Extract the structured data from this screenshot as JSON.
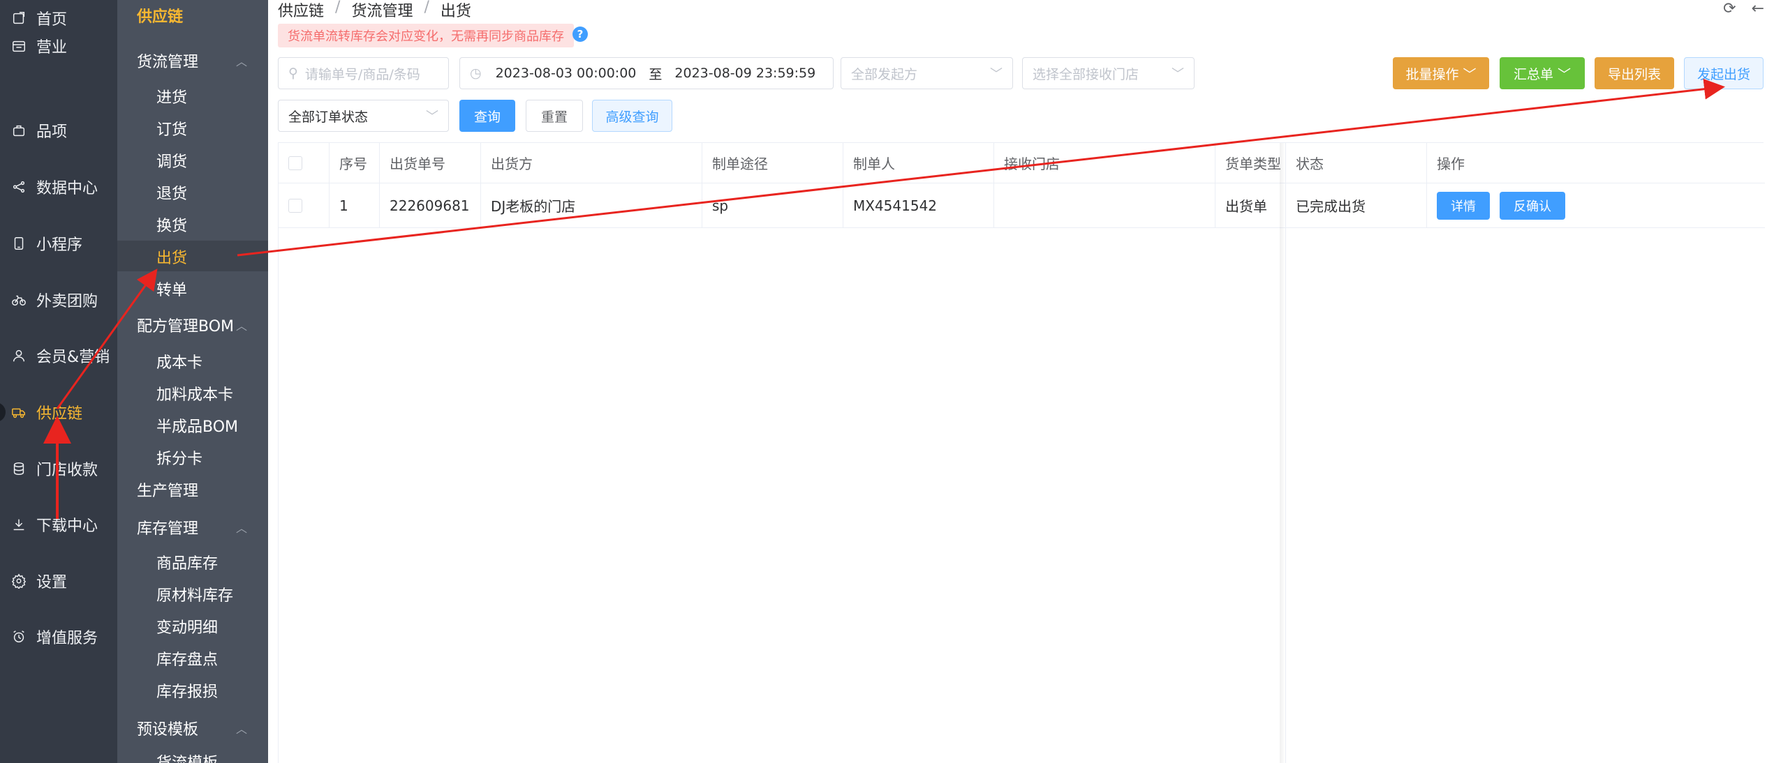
{
  "nav": {
    "items": [
      {
        "label": "首页",
        "icon": "home-icon"
      },
      {
        "label": "营业",
        "icon": "calendar-icon"
      },
      {
        "label": "品项",
        "icon": "bag-icon"
      },
      {
        "label": "数据中心",
        "icon": "share-icon"
      },
      {
        "label": "小程序",
        "icon": "phone-icon"
      },
      {
        "label": "外卖团购",
        "icon": "bike-icon"
      },
      {
        "label": "会员&营销",
        "icon": "user-icon"
      },
      {
        "label": "供应链",
        "icon": "truck-icon"
      },
      {
        "label": "门店收款",
        "icon": "coins-icon"
      },
      {
        "label": "下载中心",
        "icon": "download-icon"
      },
      {
        "label": "设置",
        "icon": "gear-icon"
      },
      {
        "label": "增值服务",
        "icon": "alarm-icon"
      }
    ],
    "active_index": 7
  },
  "subnav": {
    "title": "供应链",
    "groups": [
      {
        "label": "货流管理",
        "items": [
          "进货",
          "订货",
          "调货",
          "退货",
          "换货",
          "出货",
          "转单"
        ]
      },
      {
        "label": "配方管理BOM",
        "items": [
          "成本卡",
          "加料成本卡",
          "半成品BOM",
          "拆分卡"
        ]
      },
      {
        "label": "生产管理",
        "items": []
      },
      {
        "label": "库存管理",
        "items": [
          "商品库存",
          "原材料库存",
          "变动明细",
          "库存盘点",
          "库存报损"
        ]
      },
      {
        "label": "预设模板",
        "items": [
          "货流模板"
        ]
      }
    ],
    "active_item": "出货"
  },
  "breadcrumb": [
    "供应链",
    "货流管理",
    "出货"
  ],
  "tip": "货流单流转库存会对应变化，无需再同步商品库存",
  "help_label": "?",
  "filters": {
    "search_placeholder": "请输单号/商品/条码",
    "date_start": "2023-08-03 00:00:00",
    "date_sep": "至",
    "date_end": "2023-08-09 23:59:59",
    "sender_placeholder": "全部发起方",
    "receiver_placeholder": "选择全部接收门店",
    "status_value": "全部订单状态"
  },
  "buttons": {
    "query": "查询",
    "reset": "重置",
    "advanced": "高级查询",
    "batch": "批量操作",
    "summary": "汇总单",
    "export": "导出列表",
    "create": "发起出货"
  },
  "table": {
    "headers": [
      "序号",
      "出货单号",
      "出货方",
      "制单途径",
      "制单人",
      "接收门店",
      "货单类型",
      "状态",
      "操作"
    ],
    "rows": [
      {
        "index": "1",
        "order_no": "222609681",
        "sender": "DJ老板的门店",
        "channel": "sp",
        "creator": "MX4541542",
        "receiver": "",
        "type": "出货单",
        "status": "已完成出货",
        "actions": [
          "详情",
          "反确认"
        ]
      }
    ]
  },
  "colors": {
    "accent": "#f7b731",
    "annotation_arrow": "#e8241f",
    "primary": "#409eff"
  }
}
